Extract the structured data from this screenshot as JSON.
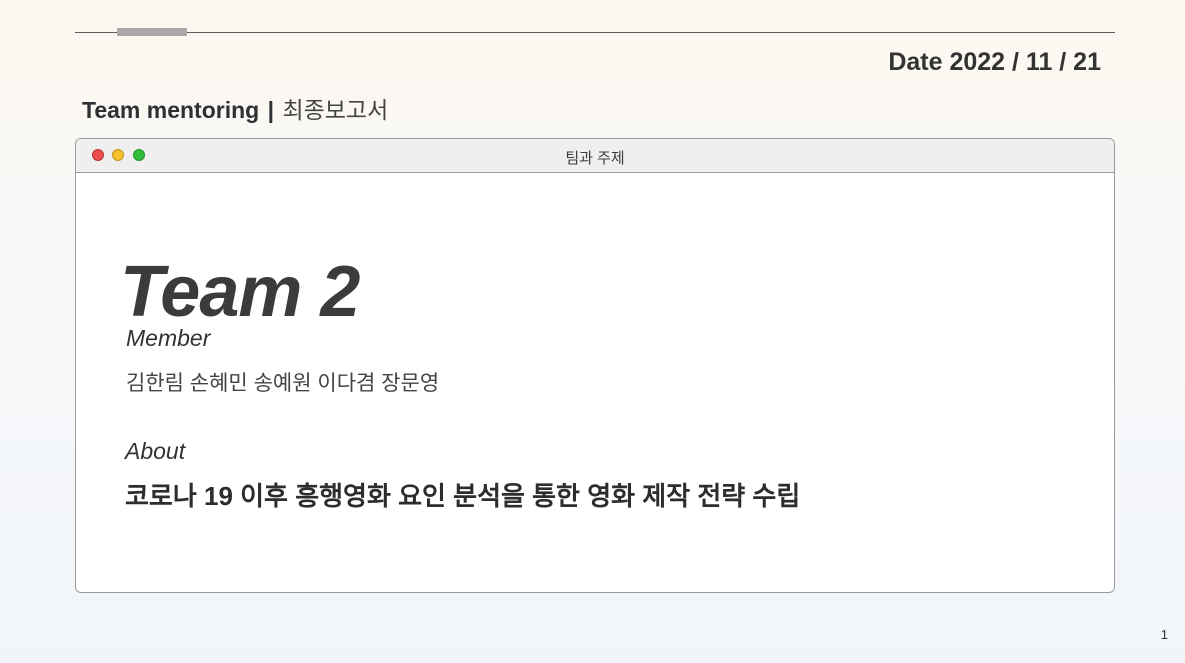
{
  "header": {
    "date_text": "Date 2022 / 11 / 21",
    "title_bold": "Team mentoring",
    "title_separator": "|",
    "title_light": "최종보고서"
  },
  "window": {
    "title": "팀과 주제",
    "controls": {
      "close_color": "#ee4c4c",
      "minimize_color": "#f5c02e",
      "maximize_color": "#33bd3c"
    }
  },
  "content": {
    "team_name": "Team 2",
    "member_label": "Member",
    "member_names": "김한림 손혜민 송예원 이다겸 장문영",
    "about_label": "About",
    "about_text": "코로나 19 이후 흥행영화 요인 분석을 통한 영화 제작 전략 수립"
  },
  "footer": {
    "page_number": "1"
  }
}
